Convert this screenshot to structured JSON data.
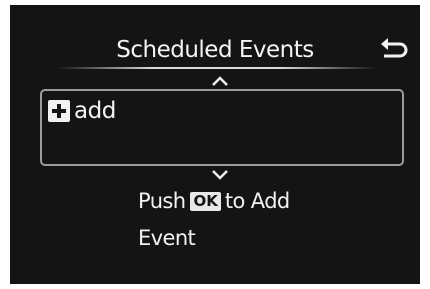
{
  "screen": {
    "title": "Scheduled Events",
    "back_icon": "return-arrow-icon",
    "scroll_up_icon": "chevron-up-icon",
    "scroll_down_icon": "chevron-down-icon"
  },
  "list": {
    "items": [
      {
        "icon": "plus-box-icon",
        "label": "add"
      }
    ]
  },
  "hint": {
    "prefix": "Push",
    "button": "OK",
    "suffix": "to Add",
    "line2": "Event"
  },
  "colors": {
    "background": "#141414",
    "text": "#f2f2f2",
    "border": "#9c9c9c"
  }
}
